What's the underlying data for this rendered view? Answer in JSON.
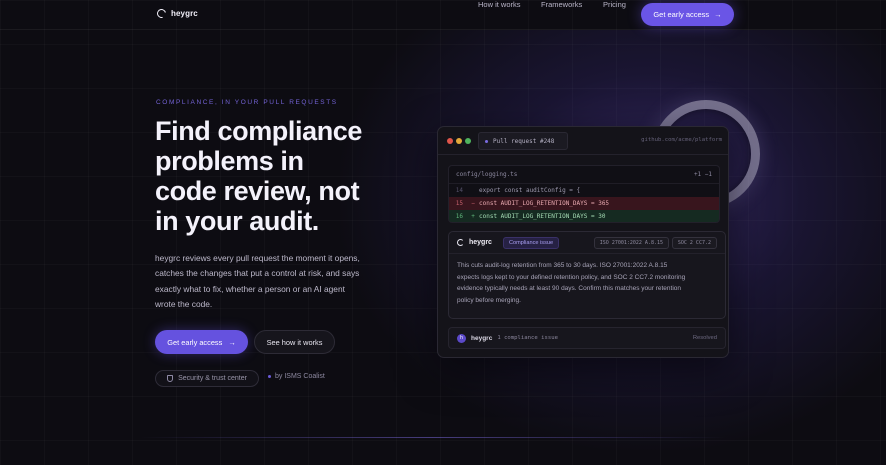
{
  "nav": {
    "brand": "heygrc",
    "links": [
      "How it works",
      "Frameworks",
      "Pricing"
    ],
    "cta_label": "Get early access",
    "cta_arrow": "→"
  },
  "hero": {
    "eyebrow": "COMPLIANCE, IN YOUR PULL REQUESTS",
    "headline": [
      "Find compliance",
      "problems in",
      "code review, not",
      "in your audit."
    ],
    "body": [
      "heygrc reviews every pull request the moment it opens,",
      "catches the changes that put a control at risk, and says",
      "exactly what to fix, whether a person or an AI agent",
      "wrote the code."
    ],
    "primary_cta": "Get early access",
    "primary_arrow": "→",
    "secondary_cta": "See how it works",
    "trust_label": "Security & trust center",
    "isms_label": "by ISMS Coalist"
  },
  "card": {
    "tab_label": "Pull request #248",
    "url": "github.com/acme/platform",
    "file_path": "config/logging.ts",
    "file_meta": "+1 −1",
    "code_lines": [
      {
        "ln": "14",
        "sign": "",
        "code": "export const auditConfig = {",
        "kind": "normal"
      },
      {
        "ln": "15",
        "sign": "−",
        "code": "  const AUDIT_LOG_RETENTION_DAYS = 365",
        "kind": "del"
      },
      {
        "ln": "16",
        "sign": "+",
        "code": "  const AUDIT_LOG_RETENTION_DAYS = 30",
        "kind": "add"
      }
    ],
    "finding": {
      "brand": "heygrc",
      "badge": "Compliance issue",
      "tags": [
        "ISO 27001:2022 A.8.15",
        "SOC 2 CC7.2"
      ],
      "text": [
        "This cuts audit-log retention from 365 to 30 days. ISO 27001:2022 A.8.15",
        "expects logs kept to your defined retention policy, and SOC 2 CC7.2 monitoring",
        "evidence typically needs at least 90 days. Confirm this matches your retention",
        "policy before merging."
      ]
    },
    "footer": {
      "avatar": "h",
      "brand": "heygrc",
      "issue": "1 compliance issue",
      "status": "Resolved"
    }
  },
  "colors": {
    "accent": "#6a55e6",
    "background": "#0d0c12"
  }
}
